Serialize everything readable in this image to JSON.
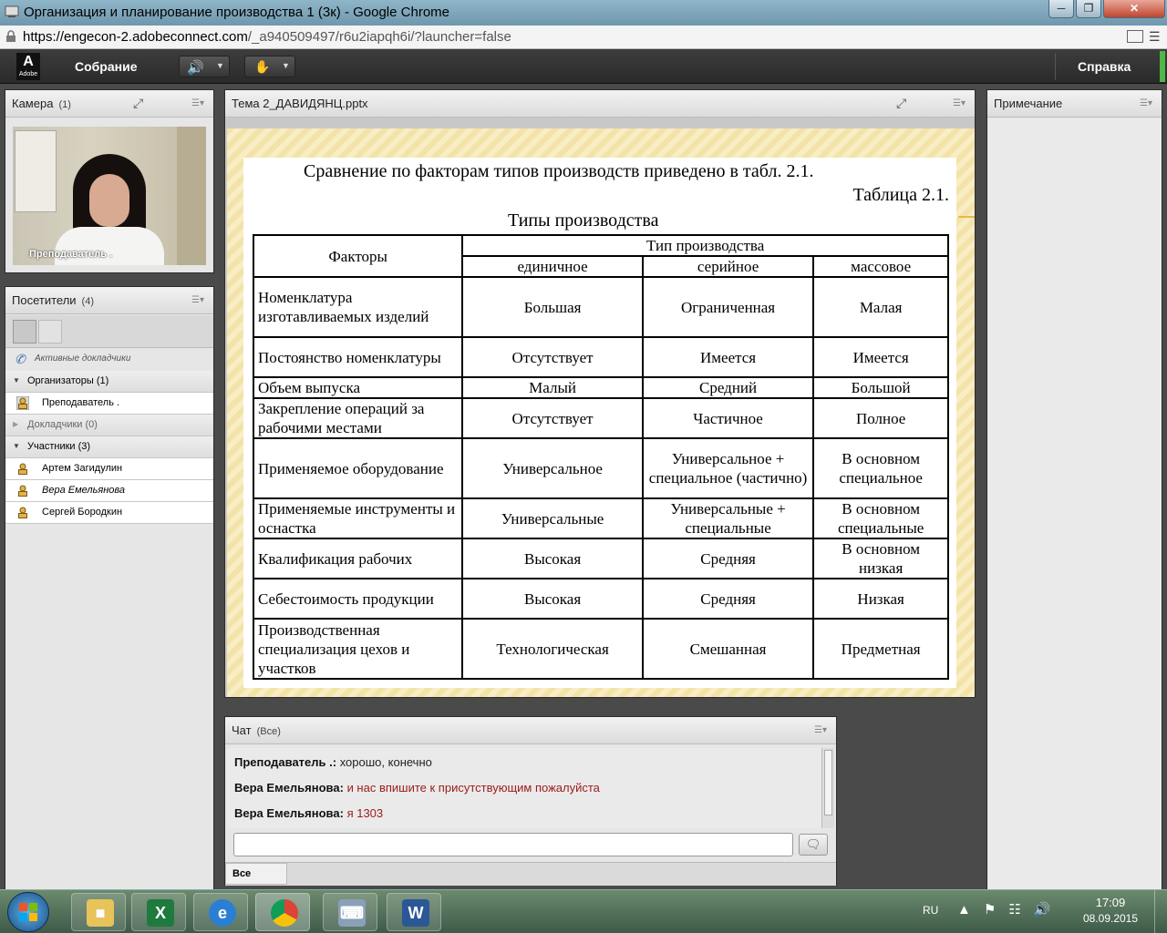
{
  "window": {
    "title": "Организация и планирование производства 1 (3к) - Google Chrome"
  },
  "address": {
    "url_host": "https://engecon-2.adobeconnect.com",
    "url_rest": "/_a940509497/r6u2iapqh6i/?launcher=false"
  },
  "appbar": {
    "logo": "Adobe",
    "meeting_menu": "Собрание",
    "help_menu": "Справка"
  },
  "camera_pod": {
    "title": "Камера",
    "count": "(1)",
    "video_label": "Преподаватель ."
  },
  "attendees_pod": {
    "title": "Посетители",
    "count": "(4)",
    "active_speakers": "Активные докладчики",
    "groups": [
      {
        "label": "Организаторы (1)",
        "members": [
          "Преподаватель ."
        ]
      },
      {
        "label": "Докладчики (0)",
        "members": []
      },
      {
        "label": "Участники (3)",
        "members": [
          "Артем Загидулин",
          "Вера Емельянова",
          "Сергей Бородкин"
        ]
      }
    ]
  },
  "share_pod": {
    "title": "Тема 2_ДАВИДЯНЦ.pptx",
    "slide": {
      "line1": "Сравнение по факторам типов производств приведено в табл. 2.1.",
      "line2": "Таблица 2.1.",
      "line3": "Типы производства",
      "head_factors": "Факторы",
      "head_type": "Тип производства",
      "columns": [
        "единичное",
        "серийное",
        "массовое"
      ],
      "rows": [
        [
          "Номенклатура изготавливаемых изделий",
          "Большая",
          "Ограниченная",
          "Малая"
        ],
        [
          "Постоянство номенклатуры",
          "Отсутствует",
          "Имеется",
          "Имеется"
        ],
        [
          "Объем выпуска",
          "Малый",
          "Средний",
          "Большой"
        ],
        [
          "Закрепление операций за рабочими местами",
          "Отсутствует",
          "Частичное",
          "Полное"
        ],
        [
          "Применяемое оборудование",
          "Универсальное",
          "Универсальное + специальное (частично)",
          "В основном специальное"
        ],
        [
          "Применяемые инструменты и оснастка",
          "Универсальные",
          "Универсальные + специальные",
          "В основном специальные"
        ],
        [
          "Квалификация рабочих",
          "Высокая",
          "Средняя",
          "В основном низкая"
        ],
        [
          "Себестоимость продукции",
          "Высокая",
          "Средняя",
          "Низкая"
        ],
        [
          "Производственная специализация цехов и участков",
          "Технологическая",
          "Смешанная",
          "Предметная"
        ]
      ]
    }
  },
  "notes_pod": {
    "title": "Примечание"
  },
  "chat_pod": {
    "title": "Чат",
    "scope": "(Все)",
    "messages": [
      {
        "who": "Преподаватель .:",
        "text": "хорошо, конечно"
      },
      {
        "who": "Вера Емельянова:",
        "text": "и нас впишите к присутствующим пожалуйста"
      },
      {
        "who": "Вера Емельянова:",
        "text": "я 1303"
      }
    ],
    "input_placeholder": "",
    "tab_all": "Все"
  },
  "taskbar": {
    "lang": "RU",
    "time": "17:09",
    "date": "08.09.2015"
  },
  "colors": {
    "accent_green": "#4db848",
    "chat_red": "#9b1b1b"
  }
}
